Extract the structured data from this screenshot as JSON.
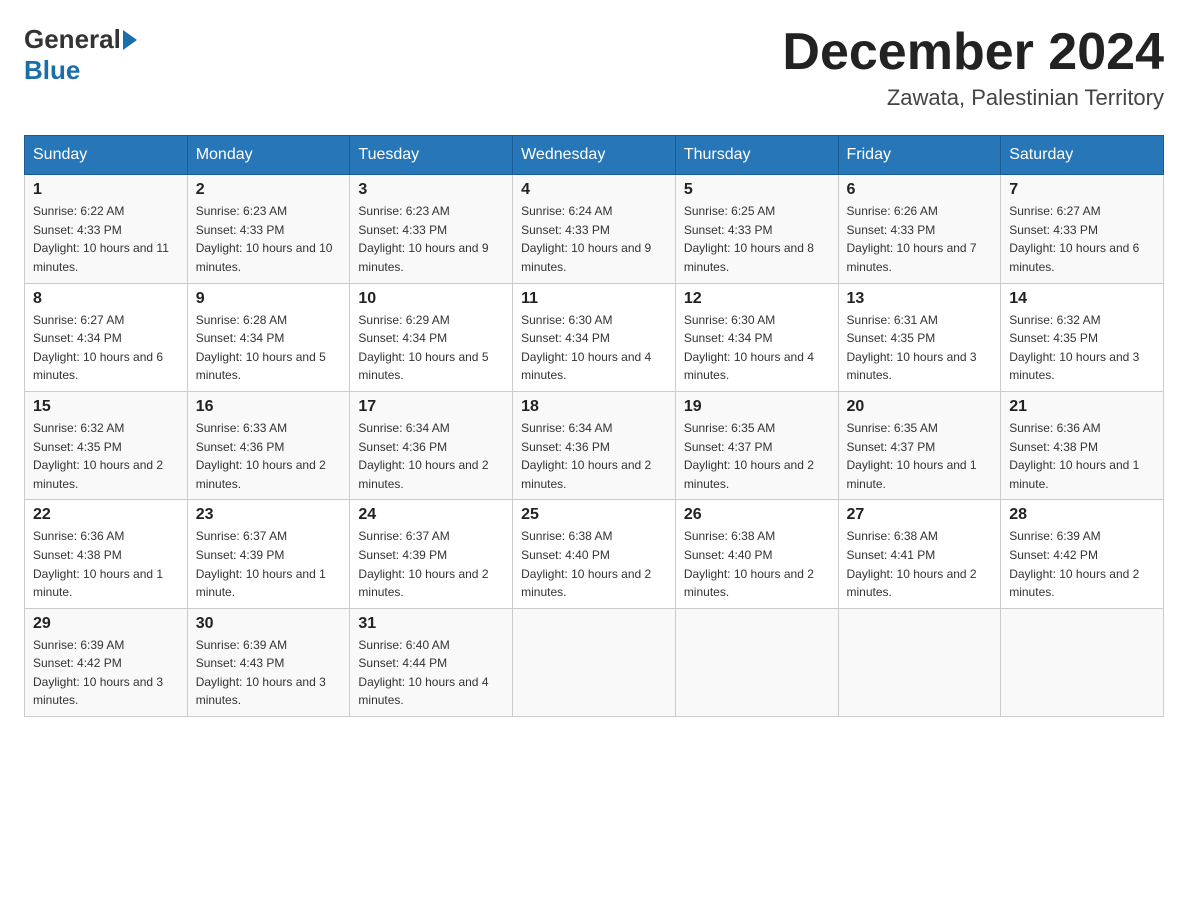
{
  "header": {
    "logo_general": "General",
    "logo_blue": "Blue",
    "month_title": "December 2024",
    "location": "Zawata, Palestinian Territory"
  },
  "columns": [
    "Sunday",
    "Monday",
    "Tuesday",
    "Wednesday",
    "Thursday",
    "Friday",
    "Saturday"
  ],
  "weeks": [
    [
      {
        "day": "1",
        "sunrise": "6:22 AM",
        "sunset": "4:33 PM",
        "daylight": "10 hours and 11 minutes."
      },
      {
        "day": "2",
        "sunrise": "6:23 AM",
        "sunset": "4:33 PM",
        "daylight": "10 hours and 10 minutes."
      },
      {
        "day": "3",
        "sunrise": "6:23 AM",
        "sunset": "4:33 PM",
        "daylight": "10 hours and 9 minutes."
      },
      {
        "day": "4",
        "sunrise": "6:24 AM",
        "sunset": "4:33 PM",
        "daylight": "10 hours and 9 minutes."
      },
      {
        "day": "5",
        "sunrise": "6:25 AM",
        "sunset": "4:33 PM",
        "daylight": "10 hours and 8 minutes."
      },
      {
        "day": "6",
        "sunrise": "6:26 AM",
        "sunset": "4:33 PM",
        "daylight": "10 hours and 7 minutes."
      },
      {
        "day": "7",
        "sunrise": "6:27 AM",
        "sunset": "4:33 PM",
        "daylight": "10 hours and 6 minutes."
      }
    ],
    [
      {
        "day": "8",
        "sunrise": "6:27 AM",
        "sunset": "4:34 PM",
        "daylight": "10 hours and 6 minutes."
      },
      {
        "day": "9",
        "sunrise": "6:28 AM",
        "sunset": "4:34 PM",
        "daylight": "10 hours and 5 minutes."
      },
      {
        "day": "10",
        "sunrise": "6:29 AM",
        "sunset": "4:34 PM",
        "daylight": "10 hours and 5 minutes."
      },
      {
        "day": "11",
        "sunrise": "6:30 AM",
        "sunset": "4:34 PM",
        "daylight": "10 hours and 4 minutes."
      },
      {
        "day": "12",
        "sunrise": "6:30 AM",
        "sunset": "4:34 PM",
        "daylight": "10 hours and 4 minutes."
      },
      {
        "day": "13",
        "sunrise": "6:31 AM",
        "sunset": "4:35 PM",
        "daylight": "10 hours and 3 minutes."
      },
      {
        "day": "14",
        "sunrise": "6:32 AM",
        "sunset": "4:35 PM",
        "daylight": "10 hours and 3 minutes."
      }
    ],
    [
      {
        "day": "15",
        "sunrise": "6:32 AM",
        "sunset": "4:35 PM",
        "daylight": "10 hours and 2 minutes."
      },
      {
        "day": "16",
        "sunrise": "6:33 AM",
        "sunset": "4:36 PM",
        "daylight": "10 hours and 2 minutes."
      },
      {
        "day": "17",
        "sunrise": "6:34 AM",
        "sunset": "4:36 PM",
        "daylight": "10 hours and 2 minutes."
      },
      {
        "day": "18",
        "sunrise": "6:34 AM",
        "sunset": "4:36 PM",
        "daylight": "10 hours and 2 minutes."
      },
      {
        "day": "19",
        "sunrise": "6:35 AM",
        "sunset": "4:37 PM",
        "daylight": "10 hours and 2 minutes."
      },
      {
        "day": "20",
        "sunrise": "6:35 AM",
        "sunset": "4:37 PM",
        "daylight": "10 hours and 1 minute."
      },
      {
        "day": "21",
        "sunrise": "6:36 AM",
        "sunset": "4:38 PM",
        "daylight": "10 hours and 1 minute."
      }
    ],
    [
      {
        "day": "22",
        "sunrise": "6:36 AM",
        "sunset": "4:38 PM",
        "daylight": "10 hours and 1 minute."
      },
      {
        "day": "23",
        "sunrise": "6:37 AM",
        "sunset": "4:39 PM",
        "daylight": "10 hours and 1 minute."
      },
      {
        "day": "24",
        "sunrise": "6:37 AM",
        "sunset": "4:39 PM",
        "daylight": "10 hours and 2 minutes."
      },
      {
        "day": "25",
        "sunrise": "6:38 AM",
        "sunset": "4:40 PM",
        "daylight": "10 hours and 2 minutes."
      },
      {
        "day": "26",
        "sunrise": "6:38 AM",
        "sunset": "4:40 PM",
        "daylight": "10 hours and 2 minutes."
      },
      {
        "day": "27",
        "sunrise": "6:38 AM",
        "sunset": "4:41 PM",
        "daylight": "10 hours and 2 minutes."
      },
      {
        "day": "28",
        "sunrise": "6:39 AM",
        "sunset": "4:42 PM",
        "daylight": "10 hours and 2 minutes."
      }
    ],
    [
      {
        "day": "29",
        "sunrise": "6:39 AM",
        "sunset": "4:42 PM",
        "daylight": "10 hours and 3 minutes."
      },
      {
        "day": "30",
        "sunrise": "6:39 AM",
        "sunset": "4:43 PM",
        "daylight": "10 hours and 3 minutes."
      },
      {
        "day": "31",
        "sunrise": "6:40 AM",
        "sunset": "4:44 PM",
        "daylight": "10 hours and 4 minutes."
      },
      null,
      null,
      null,
      null
    ]
  ]
}
